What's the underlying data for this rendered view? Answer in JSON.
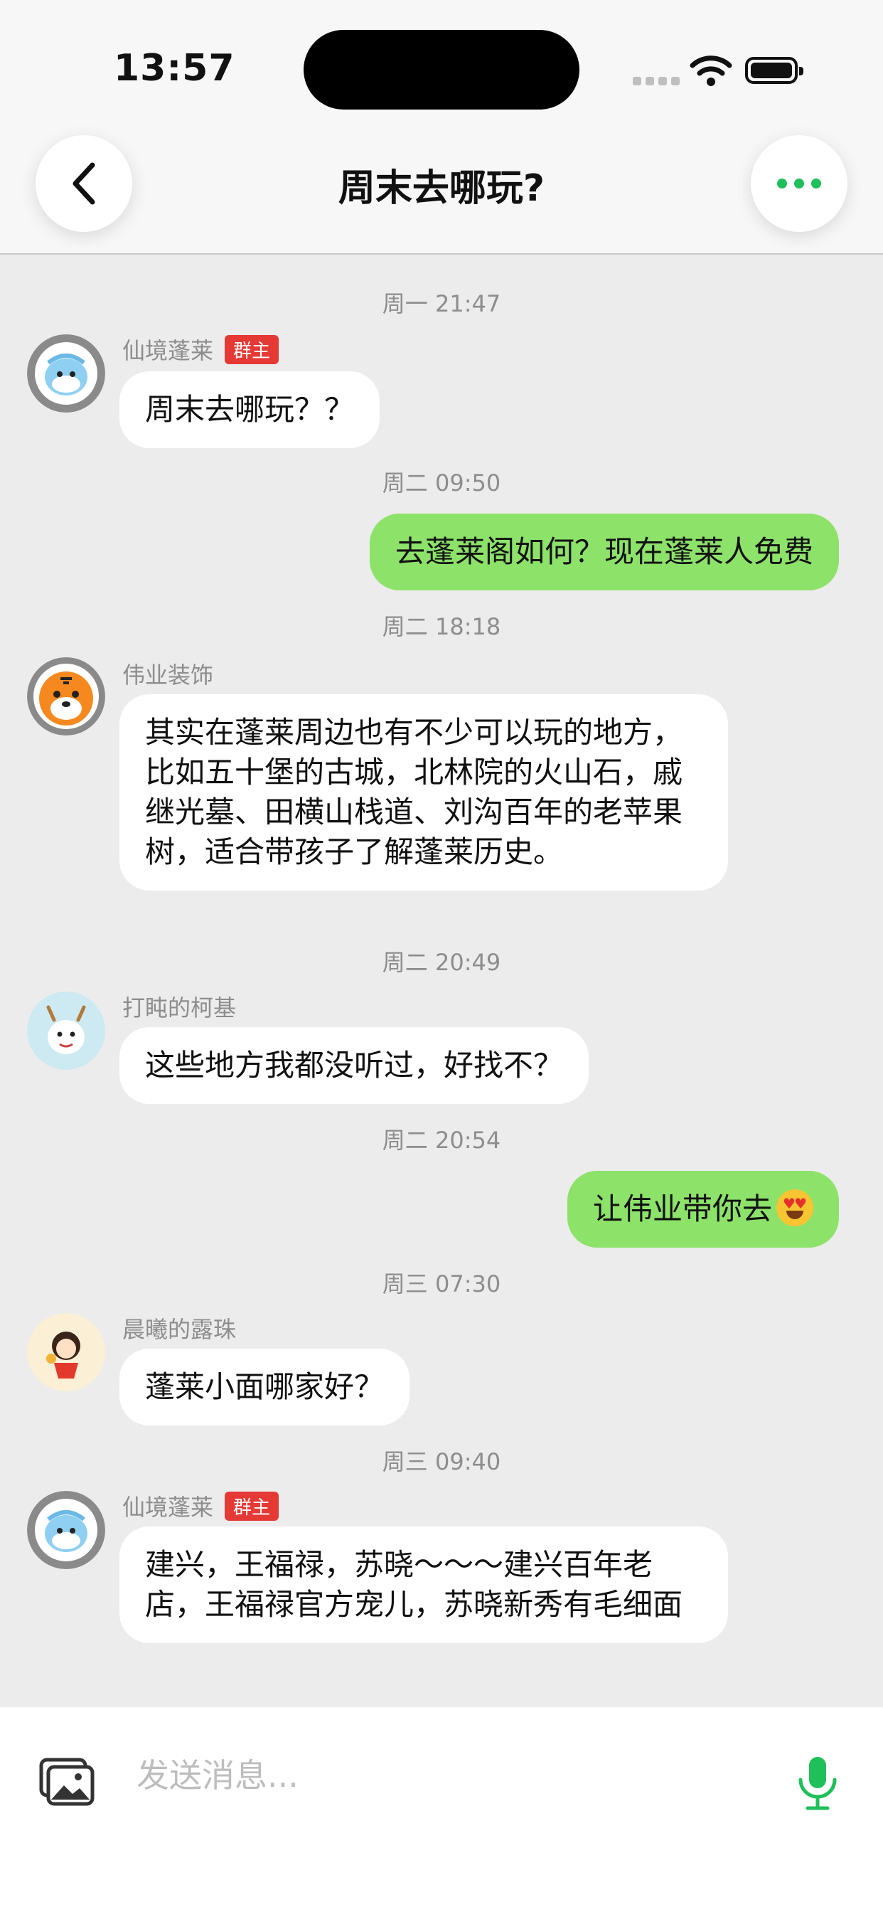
{
  "status_bar": {
    "time": "13:57"
  },
  "header": {
    "title": "周末去哪玩?"
  },
  "messages": [
    {
      "type": "timestamp",
      "text": "周一 21:47"
    },
    {
      "type": "incoming",
      "sender": "仙境蓬莱",
      "badge": "群主",
      "avatar": "dolphin-avatar",
      "text": "周末去哪玩？？"
    },
    {
      "type": "timestamp",
      "text": "周二 09:50"
    },
    {
      "type": "outgoing",
      "text": "去蓬莱阁如何？现在蓬莱人免费"
    },
    {
      "type": "timestamp",
      "text": "周二 18:18"
    },
    {
      "type": "incoming",
      "sender": "伟业装饰",
      "avatar": "tiger-avatar",
      "text": "其实在蓬莱周边也有不少可以玩的地方，比如五十堡的古城，北林院的火山石，戚继光墓、田横山栈道、刘沟百年的老苹果树，适合带孩子了解蓬莱历史。"
    },
    {
      "type": "timestamp",
      "text": "周二 20:49"
    },
    {
      "type": "incoming",
      "sender": "打盹的柯基",
      "avatar": "dragon-avatar",
      "text": "这些地方我都没听过，好找不？"
    },
    {
      "type": "timestamp",
      "text": "周二 20:54"
    },
    {
      "type": "outgoing",
      "text": "让伟业带你去",
      "emoji": "heart-eyes-emoji"
    },
    {
      "type": "timestamp",
      "text": "周三 07:30"
    },
    {
      "type": "incoming",
      "sender": "晨曦的露珠",
      "avatar": "girl-avatar",
      "text": "蓬莱小面哪家好？"
    },
    {
      "type": "timestamp",
      "text": "周三 09:40"
    },
    {
      "type": "incoming",
      "sender": "仙境蓬莱",
      "badge": "群主",
      "avatar": "dolphin-avatar",
      "text": "建兴，王福禄，苏晓～～～建兴百年老店，王福禄官方宠儿，苏晓新秀有毛细面"
    }
  ],
  "input": {
    "placeholder": "发送消息..."
  },
  "colors": {
    "accent": "#1fbf5a",
    "outgoing_bubble": "#8de26a",
    "badge": "#e53935"
  }
}
